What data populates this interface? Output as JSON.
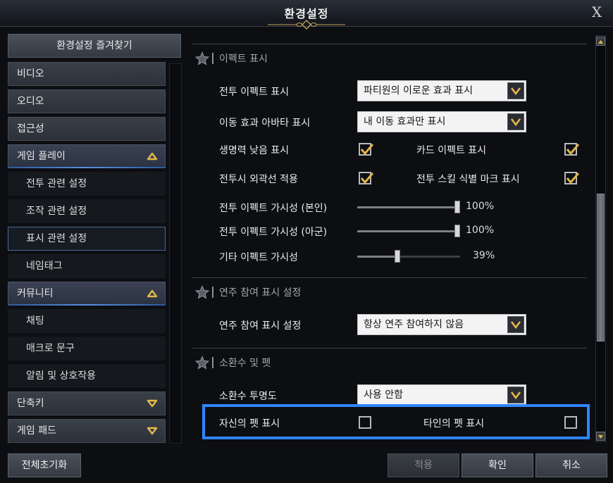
{
  "window": {
    "title": "환경설정",
    "close_label": "X"
  },
  "sidebar": {
    "favorites_button": "환경설정 즐겨찾기",
    "items": [
      {
        "label": "비디오",
        "type": "category"
      },
      {
        "label": "오디오",
        "type": "category"
      },
      {
        "label": "접근성",
        "type": "category"
      },
      {
        "label": "게임 플레이",
        "type": "category",
        "expanded": true
      },
      {
        "label": "전투 관련 설정",
        "type": "sub"
      },
      {
        "label": "조작 관련 설정",
        "type": "sub"
      },
      {
        "label": "표시 관련 설정",
        "type": "sub",
        "active": true
      },
      {
        "label": "네임태그",
        "type": "sub"
      },
      {
        "label": "커뮤니티",
        "type": "category",
        "expanded": true
      },
      {
        "label": "채팅",
        "type": "sub"
      },
      {
        "label": "매크로 문구",
        "type": "sub"
      },
      {
        "label": "알림 및 상호작용",
        "type": "sub"
      },
      {
        "label": "단축키",
        "type": "category",
        "expanded": false
      },
      {
        "label": "게임 패드",
        "type": "category",
        "expanded": false
      }
    ]
  },
  "sections": {
    "effects": {
      "title": "이펙트 표시",
      "combat_effect_label": "전투 이펙트 표시",
      "combat_effect_value": "파티원의 이로운 효과 표시",
      "move_avatar_label": "이동 효과 아바타 표시",
      "move_avatar_value": "내 이동 효과만 표시",
      "low_hp_label": "생명력 낮음 표시",
      "low_hp_checked": true,
      "card_effect_label": "카드 이펙트 표시",
      "card_effect_checked": true,
      "outline_label": "전투시 외곽선 적용",
      "outline_checked": true,
      "skill_mark_label": "전투 스킬 식별 마크 표시",
      "skill_mark_checked": true,
      "vis_self_label": "전투 이펙트 가시성 (본인)",
      "vis_self_value": 100,
      "vis_self_text": "100%",
      "vis_ally_label": "전투 이펙트 가시성 (아군)",
      "vis_ally_value": 100,
      "vis_ally_text": "100%",
      "vis_other_label": "기타 이펙트 가시성",
      "vis_other_value": 39,
      "vis_other_text": "39%"
    },
    "performance": {
      "title": "연주 참여 표시 설정",
      "setting_label": "연주 참여 표시 설정",
      "setting_value": "항상 연주 참여하지 않음"
    },
    "summons": {
      "title": "소환수 및 펫",
      "opacity_label": "소환수 투명도",
      "opacity_value": "사용 안함",
      "own_pet_label": "자신의 펫 표시",
      "own_pet_checked": false,
      "other_pet_label": "타인의 펫 표시",
      "other_pet_checked": false
    }
  },
  "footer": {
    "reset_label": "전체초기화",
    "apply_label": "적용",
    "confirm_label": "확인",
    "cancel_label": "취소"
  },
  "colors": {
    "accent_blue": "#2f85ff",
    "check_gold": "#e0b24a",
    "chevron_gold": "#e3b84a"
  }
}
